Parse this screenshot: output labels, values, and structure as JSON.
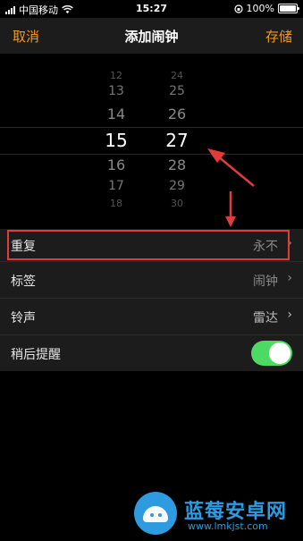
{
  "status_bar": {
    "carrier": "中国移动",
    "time": "15:27",
    "battery": "100%",
    "battery_level": 1.0
  },
  "nav": {
    "cancel_label": "取消",
    "title": "添加闹钟",
    "save_label": "存储"
  },
  "picker": {
    "hours": [
      "12",
      "13",
      "14",
      "15",
      "16",
      "17",
      "18"
    ],
    "minutes": [
      "24",
      "25",
      "26",
      "27",
      "28",
      "29",
      "30"
    ],
    "selected_hour": "15",
    "selected_minute": "27"
  },
  "settings": {
    "repeat": {
      "label": "重复",
      "value": "永不"
    },
    "tag": {
      "label": "标签",
      "value": "闹钟"
    },
    "sound": {
      "label": "铃声",
      "value": "雷达"
    },
    "snooze": {
      "label": "稍后提醒",
      "on": true
    }
  },
  "watermark": {
    "name": "蓝莓安卓网",
    "url": "www.lmkjst.com"
  },
  "colors": {
    "accent": "#f29a1f",
    "toggle_on": "#4cd964",
    "annotation": "#e53a3a",
    "nav_bg": "#1c1c1c"
  }
}
